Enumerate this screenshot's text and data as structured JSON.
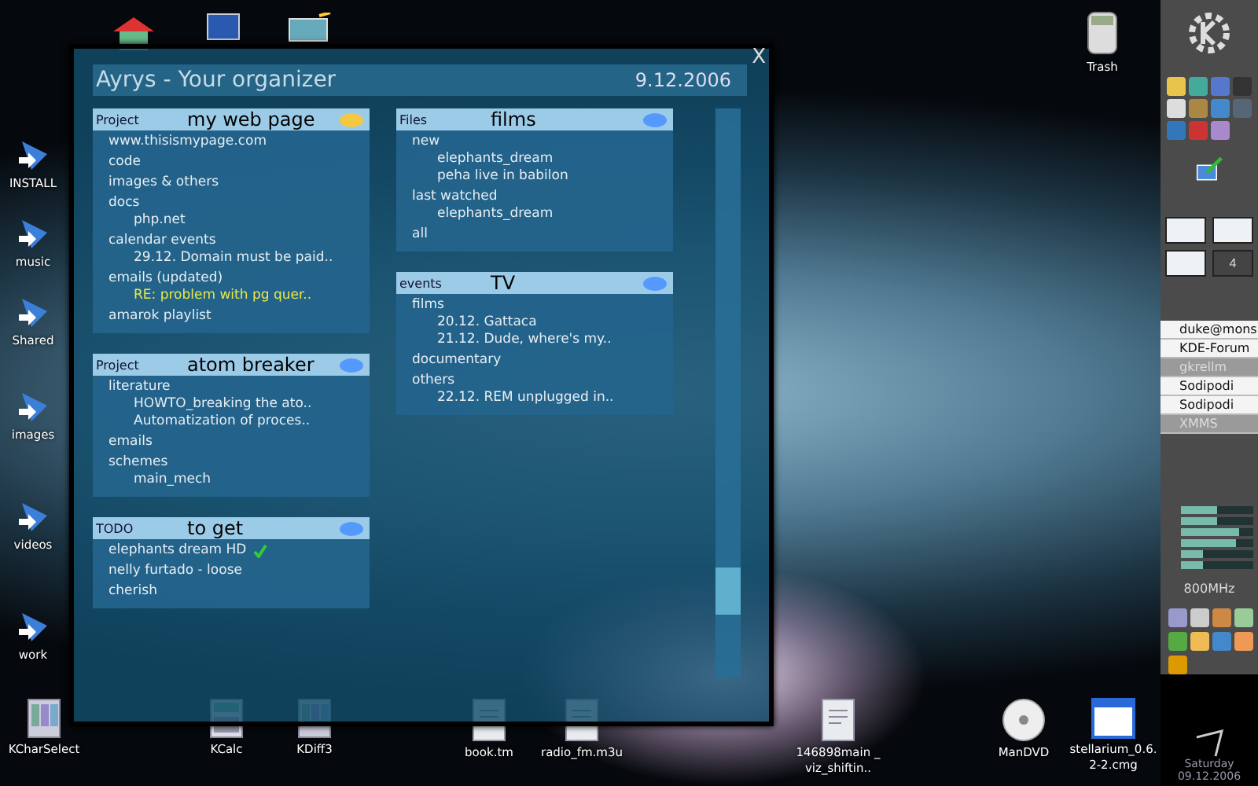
{
  "desktop_icons": [
    {
      "label": "INSTALL",
      "kind": "link"
    },
    {
      "label": "music",
      "kind": "link"
    },
    {
      "label": "Shared",
      "kind": "link"
    },
    {
      "label": "images",
      "kind": "link"
    },
    {
      "label": "videos",
      "kind": "link"
    },
    {
      "label": "work",
      "kind": "link"
    },
    {
      "label": "Trash",
      "kind": "trash"
    },
    {
      "label": "KCharSelect",
      "kind": "app"
    },
    {
      "label": "KCalc",
      "kind": "calculator"
    },
    {
      "label": "KDiff3",
      "kind": "app"
    },
    {
      "label": "book.tm",
      "kind": "document"
    },
    {
      "label": "radio_fm.m3u",
      "kind": "document"
    },
    {
      "label": "146898main _viz_shiftin..",
      "kind": "document"
    },
    {
      "label": "ManDVD",
      "kind": "disc"
    },
    {
      "label": "stellarium_0.6.2-2.cmg",
      "kind": "window"
    }
  ],
  "window": {
    "title": "Ayrys - Your organizer",
    "date": "9.12.2006",
    "close": "X"
  },
  "columns": [
    [
      {
        "type": "Project",
        "title": "my web page",
        "color": "#f4c842",
        "items": [
          {
            "text": "www.thisismypage.com",
            "highlighted": false
          },
          {
            "text": "code",
            "highlighted": false
          },
          {
            "text": "images & others",
            "highlighted": false
          },
          {
            "text": "docs",
            "highlighted": false,
            "children": [
              {
                "text": "php.net",
                "highlighted": false
              }
            ]
          },
          {
            "text": "calendar events",
            "highlighted": false,
            "children": [
              {
                "text": "29.12. Domain must be paid..",
                "highlighted": false
              }
            ]
          },
          {
            "text": "emails   (updated)",
            "highlighted": false,
            "children": [
              {
                "text": "RE: problem with pg quer..",
                "highlighted": true
              }
            ]
          },
          {
            "text": "amarok playlist",
            "highlighted": false
          }
        ]
      },
      {
        "type": "Project",
        "title": "atom breaker",
        "color": "#5599ff",
        "items": [
          {
            "text": "literature",
            "highlighted": false,
            "children": [
              {
                "text": "HOWTO_breaking the ato..",
                "highlighted": false
              },
              {
                "text": "Automatization of proces..",
                "highlighted": false
              }
            ]
          },
          {
            "text": "emails",
            "highlighted": false
          },
          {
            "text": "schemes",
            "highlighted": false,
            "children": [
              {
                "text": "main_mech",
                "highlighted": false
              }
            ]
          }
        ]
      },
      {
        "type": "TODO",
        "title": "to get",
        "color": "#5599ff",
        "items": [
          {
            "text": "elephants dream HD",
            "highlighted": false,
            "done": true
          },
          {
            "text": "nelly furtado -  loose",
            "highlighted": false,
            "done": false
          },
          {
            "text": "cherish",
            "highlighted": false,
            "done": false
          }
        ]
      }
    ],
    [
      {
        "type": "Files",
        "title": "films",
        "color": "#5599ff",
        "items": [
          {
            "text": "new",
            "highlighted": false,
            "children": [
              {
                "text": "elephants_dream",
                "highlighted": false
              },
              {
                "text": "peha live in babilon",
                "highlighted": false
              }
            ]
          },
          {
            "text": "last watched",
            "highlighted": false,
            "children": [
              {
                "text": "elephants_dream",
                "highlighted": false
              }
            ]
          },
          {
            "text": "all",
            "highlighted": false
          }
        ]
      },
      {
        "type": "events",
        "title": "TV",
        "color": "#5599ff",
        "items": [
          {
            "text": "films",
            "highlighted": false,
            "children": [
              {
                "text": "20.12. Gattaca",
                "highlighted": false
              },
              {
                "text": "21.12. Dude, where's my..",
                "highlighted": false
              }
            ]
          },
          {
            "text": "documentary",
            "highlighted": false
          },
          {
            "text": "others",
            "highlighted": false,
            "children": [
              {
                "text": "22.12. REM unplugged in..",
                "highlighted": false
              }
            ]
          }
        ]
      }
    ]
  ],
  "panel": {
    "pager": [
      {
        "selected": false
      },
      {
        "selected": false
      },
      {
        "selected": false
      },
      {
        "label": "4",
        "selected": true
      }
    ],
    "tasks": [
      {
        "label": "duke@mons",
        "minimized": false
      },
      {
        "label": "KDE-Forum",
        "minimized": false
      },
      {
        "label": "gkrellm",
        "minimized": true
      },
      {
        "label": "Sodipodi",
        "minimized": false
      },
      {
        "label": "Sodipodi",
        "minimized": false
      },
      {
        "label": "XMMS",
        "minimized": true
      }
    ],
    "meters": [
      {
        "level": 0.5
      },
      {
        "level": 0.5
      },
      {
        "level": 0.8
      },
      {
        "level": 0.75
      },
      {
        "level": 0.3
      },
      {
        "level": 0.3
      }
    ],
    "cpu": "800MHz",
    "day": "Saturday",
    "date": "09.12.2006"
  }
}
